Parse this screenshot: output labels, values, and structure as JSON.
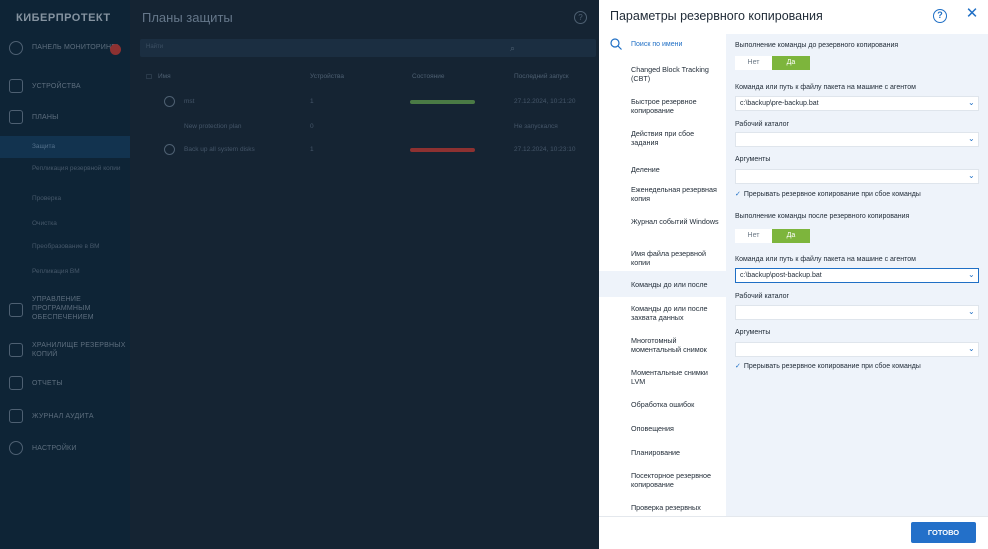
{
  "app": {
    "logo": "КИБЕРПРОТЕКТ"
  },
  "nav": {
    "dashboard": "ПАНЕЛЬ МОНИТОРИНГА",
    "devices": "УСТРОЙСТВА",
    "plans": "ПЛАНЫ",
    "sub": [
      "Защита",
      "Репликация резервной копии",
      "Проверка",
      "Очистка",
      "Преобразование в ВМ",
      "Репликация ВМ"
    ],
    "software": "УПРАВЛЕНИЕ ПРОГРАММНЫМ ОБЕСПЕЧЕНИЕМ",
    "storage": "ХРАНИЛИЩЕ РЕЗЕРВНЫХ КОПИЙ",
    "reports": "ОТЧЕТЫ",
    "audit": "ЖУРНАЛ АУДИТА",
    "settings": "НАСТРОЙКИ"
  },
  "main": {
    "title": "Планы защиты",
    "search_placeholder": "Найти",
    "columns": [
      "Имя",
      "Устройства",
      "Состояние",
      "Последний запуск"
    ],
    "rows": [
      {
        "name": "mst",
        "devices": "1",
        "status_color": "#4a7a45",
        "last": "27.12.2024, 10:21:20"
      },
      {
        "name": "New protection plan",
        "devices": "0",
        "status_color": "",
        "last": "Не запускался"
      },
      {
        "name": "Back up all system disks",
        "devices": "1",
        "status_color": "#8d3131",
        "last": "27.12.2024, 10:23:10"
      }
    ]
  },
  "panel": {
    "title": "Параметры резервного копирования",
    "help": "?",
    "close": "✕",
    "search_label": "Поиск по имени",
    "options": [
      "Changed Block Tracking (CBT)",
      "Быстрое резервное копирование",
      "Действия при сбое задания",
      "Деление",
      "Еженедельная резервная копия",
      "Журнал событий Windows",
      "Имя файла резервной копии",
      "Команды до или после",
      "Команды до или после захвата данных",
      "Многотомный моментальный снимок",
      "Моментальные снимки LVM",
      "Обработка ошибок",
      "Оповещения",
      "Планирование",
      "Посекторное резервное копирование",
      "Проверка резервных"
    ],
    "before": {
      "label": "Выполнение команды до резервного копирования",
      "no": "Нет",
      "yes": "Да",
      "cmd_label": "Команда или путь к файлу пакета на машине с агентом",
      "cmd_value": "c:\\backup\\pre-backup.bat",
      "dir_label": "Рабочий каталог",
      "args_label": "Аргументы",
      "abort_label": "Прерывать резервное копирование при сбое команды"
    },
    "after": {
      "label": "Выполнение команды после резервного копирования",
      "no": "Нет",
      "yes": "Да",
      "cmd_label": "Команда или путь к файлу пакета на машине с агентом",
      "cmd_value": "c:\\backup\\post-backup.bat",
      "dir_label": "Рабочий каталог",
      "args_label": "Аргументы",
      "abort_label": "Прерывать резервное копирование при сбое команды"
    },
    "done": "ГОТОВО"
  }
}
